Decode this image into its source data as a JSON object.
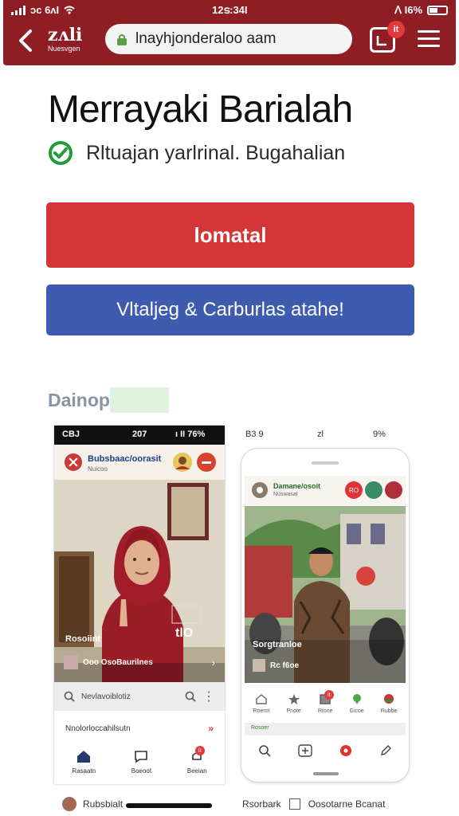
{
  "status": {
    "left_text": "ɔc 6ᴧI",
    "time": "12ട:34I",
    "right_text": "ⴷ I6%"
  },
  "browser": {
    "brand_line1": "zʌli",
    "brand_line2": "Nuesvgen",
    "url": "lnayhjonderaloo aam",
    "tabs_badge": "it"
  },
  "main": {
    "title": "Merrayaki Barialah",
    "verified_text": "Rltuajan yarlrinal. Bugahalian",
    "primary_button": "lomatal",
    "secondary_button": "Vltaljeg & Carburlas atahe!",
    "section_label": "Dainop"
  },
  "phone1": {
    "status_left": "CBJ",
    "status_time": "207",
    "status_right": "ı II 76%",
    "header_title": "Bubsbaac/oorasit",
    "header_sub": "Nuicoo",
    "photo_caption": "Rosoiint",
    "photo_badge": "tlO",
    "photo_row": "Ooo OsoBaurilnes",
    "search_text": "Nevlavoiblotiz",
    "promo_text": "Nnolorloccahilsutn",
    "nav": [
      "Rasaatn",
      "Boeoot",
      "Beeian"
    ],
    "nav_badge": "ít"
  },
  "phone2": {
    "status_left": "B3 9",
    "status_mid": "zl",
    "status_right": "9%",
    "header_title": "Damane/osoit",
    "header_sub": "Nuswasat",
    "header_badge": "RO",
    "photo_caption": "Sorgtranloe",
    "photo_row": "Rc f6oe",
    "nav": [
      "Rnerot",
      "Pnote",
      "Rtone",
      "Gicoe",
      "Rubbe"
    ],
    "nav_badge": "it",
    "sub_label": "Rosoer"
  },
  "footer": {
    "left_text": "Rubsbialt",
    "right_text1": "Rsorbark",
    "right_text2": "Oosotarne Bcanat"
  },
  "colors": {
    "chrome": "#8e1d24",
    "primary": "#d43536",
    "secondary": "#3e5bb0",
    "check": "#1e9e3a"
  }
}
